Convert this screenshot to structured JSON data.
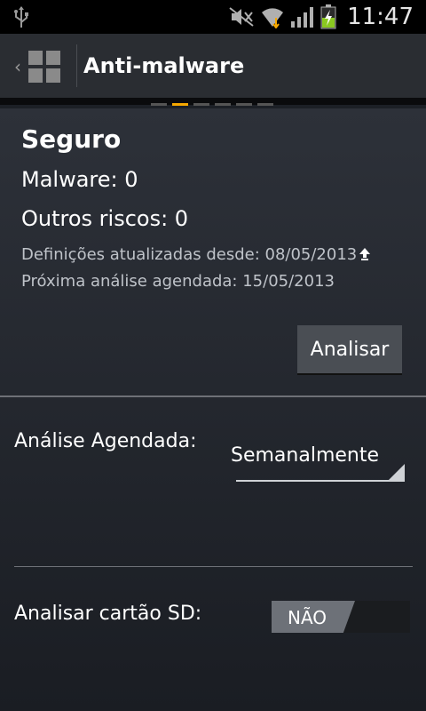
{
  "status_bar": {
    "time": "11:47",
    "icons": [
      "usb-icon",
      "no-sound-icon",
      "wifi-icon",
      "signal-icon",
      "battery-charging-icon"
    ]
  },
  "action_bar": {
    "title": "Anti-malware",
    "icon": "app-grid-icon"
  },
  "pager": {
    "pages": 6,
    "active_index": 1
  },
  "summary": {
    "status": "Seguro",
    "malware": "Malware: 0",
    "other_risks": "Outros riscos: 0",
    "definitions": "Definições atualizadas desde: 08/05/2013",
    "next_scan": "Próxima análise agendada: 15/05/2013"
  },
  "scan_button": {
    "label": "Analisar"
  },
  "schedule": {
    "label": "Análise Agendada:",
    "value": "Semanalmente"
  },
  "sd_card": {
    "label": "Analisar cartão SD:",
    "toggle_text": "NÃO"
  },
  "colors": {
    "accent": "#f6a800",
    "background": "#1c2026"
  }
}
